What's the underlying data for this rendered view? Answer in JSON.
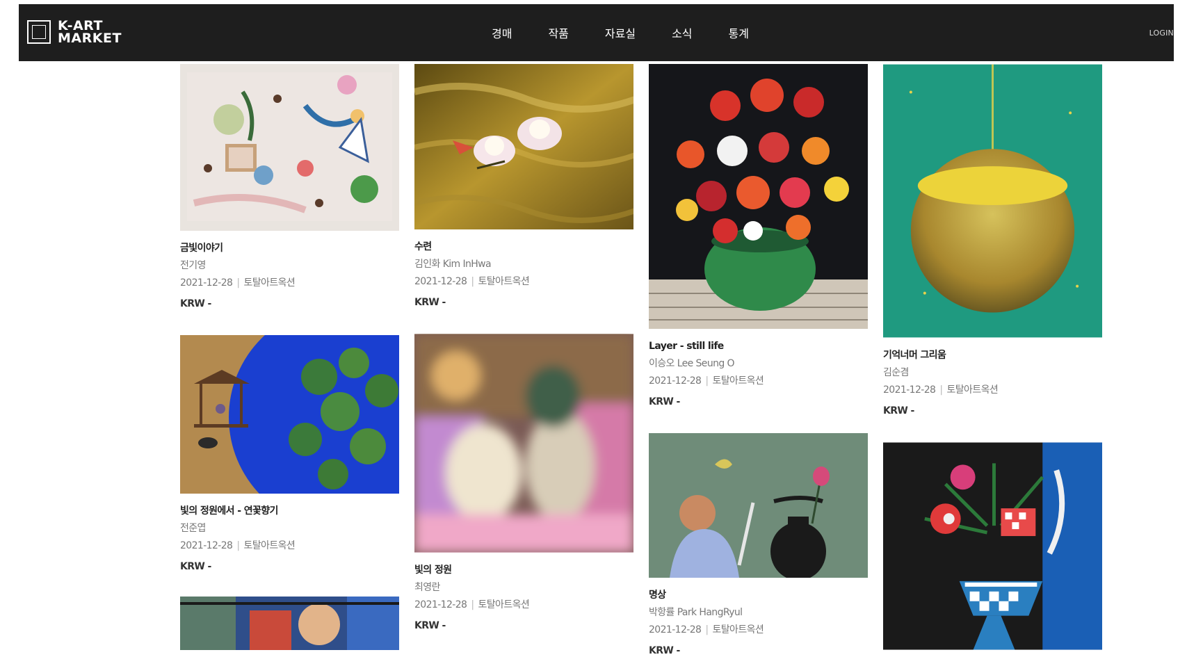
{
  "header": {
    "logo_line1": "K-ART",
    "logo_line2": "MARKET",
    "nav": [
      "경매",
      "작품",
      "자료실",
      "소식",
      "통계"
    ],
    "login": "LOGIN"
  },
  "artworks": [
    {
      "title": "금빛이야기",
      "artist": "전기영",
      "date": "2021-12-28",
      "auction": "토탈아트옥션",
      "price": "KRW -"
    },
    {
      "title": "수련",
      "artist": "김인화 Kim InHwa",
      "date": "2021-12-28",
      "auction": "토탈아트옥션",
      "price": "KRW -"
    },
    {
      "title": "Layer - still life",
      "artist": "이승오 Lee Seung O",
      "date": "2021-12-28",
      "auction": "토탈아트옥션",
      "price": "KRW -"
    },
    {
      "title": "기억너머 그리움",
      "artist": "김순겸",
      "date": "2021-12-28",
      "auction": "토탈아트옥션",
      "price": "KRW -"
    },
    {
      "title": "빛의 정원에서 - 연꽃향기",
      "artist": "전준엽",
      "date": "2021-12-28",
      "auction": "토탈아트옥션",
      "price": "KRW -"
    },
    {
      "title": "빛의 정원",
      "artist": "최영란",
      "date": "2021-12-28",
      "auction": "토탈아트옥션",
      "price": "KRW -"
    },
    {
      "title": "명상",
      "artist": "박항률 Park HangRyul",
      "date": "2021-12-28",
      "auction": "토탈아트옥션",
      "price": "KRW -"
    }
  ],
  "colors": {
    "header_bg": "#1e1e1e",
    "text_primary": "#222222",
    "text_secondary": "#777777"
  }
}
